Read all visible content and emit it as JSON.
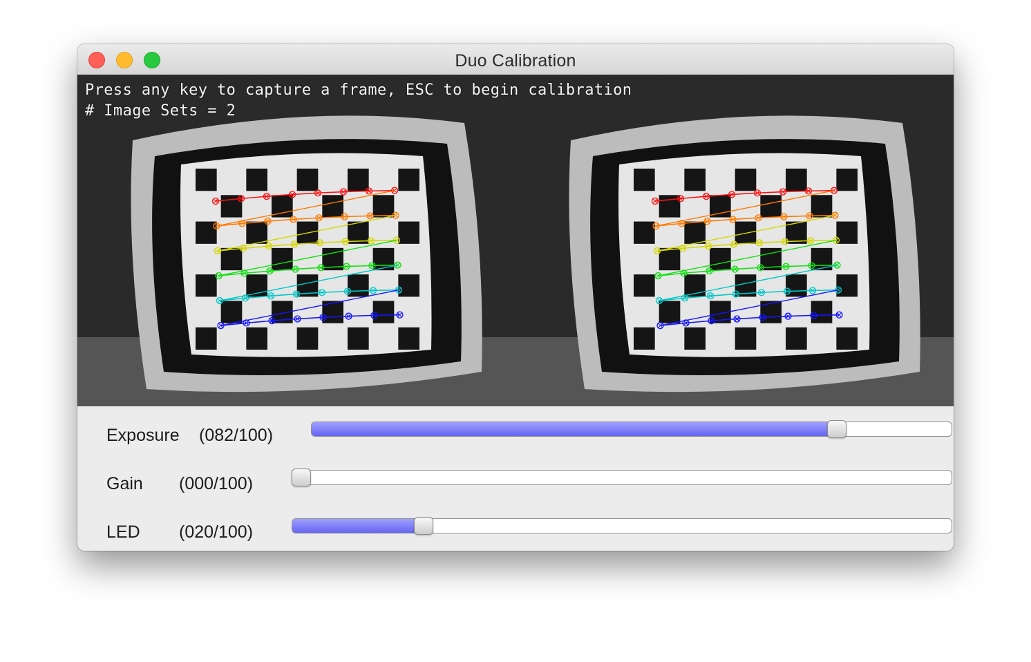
{
  "window": {
    "title": "Duo Calibration"
  },
  "camera": {
    "overlay_line1": "Press any key to capture a frame, ESC to begin calibration",
    "overlay_line2": "# Image Sets = 2",
    "views": [
      "left",
      "right"
    ],
    "row_colors": [
      "#ff1010",
      "#ff7a00",
      "#d6d600",
      "#10e010",
      "#00c8c8",
      "#1515ff"
    ]
  },
  "sliders": [
    {
      "label": "Exposure",
      "value_text": "(082/100)",
      "value": 82,
      "max": 100
    },
    {
      "label": "Gain",
      "value_text": "(000/100)",
      "value": 0,
      "max": 100
    },
    {
      "label": "LED",
      "value_text": "(020/100)",
      "value": 20,
      "max": 100
    }
  ],
  "colors": {
    "slider_fill": "#7b7bff",
    "close": "#fe5f57",
    "minimize": "#febc2e",
    "zoom": "#28c840"
  }
}
